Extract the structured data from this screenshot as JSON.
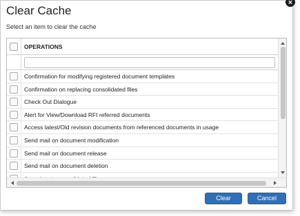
{
  "dialog": {
    "title": "Clear Cache",
    "close_label": "×",
    "subtitle": "Select an item to clear the cache"
  },
  "grid": {
    "column_header": "OPERATIONS",
    "filter": {
      "value": "",
      "placeholder": ""
    },
    "rows": [
      {
        "label": "Confirmation for modifying registered document templates",
        "checked": false
      },
      {
        "label": "Confirmation on replacing consolidated files",
        "checked": false
      },
      {
        "label": "Check Out Dialogue",
        "checked": false
      },
      {
        "label": "Alert for View/Download RFI referred documents",
        "checked": false
      },
      {
        "label": "Access latest/Old revision documents from referenced documents in usage",
        "checked": false
      },
      {
        "label": "Send mail on document modification",
        "checked": false
      },
      {
        "label": "Send mail on document release",
        "checked": false
      },
      {
        "label": "Send mail on document deletion",
        "checked": false
      },
      {
        "label": "Associate to consolidated file",
        "checked": false
      }
    ]
  },
  "buttons": {
    "clear_label": "Clear",
    "cancel_label": "Cancel"
  },
  "colors": {
    "primary_button": "#2f6fb6",
    "close_button": "#1a1a1a"
  }
}
